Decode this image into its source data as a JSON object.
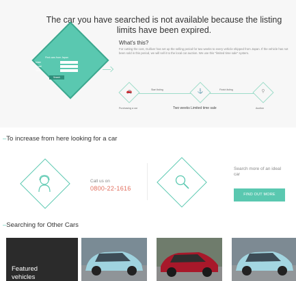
{
  "notice": {
    "headline_line1": "The car you have searched is not available because the listing",
    "headline_line2": "limits have been expired."
  },
  "search_card": {
    "title": "Find cars from Japan",
    "field1_label": "Make",
    "field2_label": "Model",
    "field3_label": "Year",
    "button_label": "Search"
  },
  "explainer": {
    "title": "What's this?",
    "body": "For cutting the cost, Gulliver has set up the selling period for two weeks to every vehicle shipped from Japan. If the vehicle has not been sold in this period, we will sell it to the local car auction. We use this \"limited time sale\" system."
  },
  "timeline": {
    "start_listing": "Start listing",
    "finish_listing": "Finish listing",
    "purchasing": "Purchasing a car",
    "period": "Two weeks Limited time sale",
    "auction": "Auction"
  },
  "contact": {
    "section_title": "To increase from here looking for a car",
    "call_label": "Call us on",
    "phone": "0800-22-1616",
    "search_label": "Search more of an ideal car",
    "find_button": "FIND OUT MORE"
  },
  "other_cars": {
    "section_title": "Searching for Other Cars",
    "featured_label_line1": "Featured",
    "featured_label_line2": "vehicles"
  },
  "colors": {
    "accent": "#5ac8b0",
    "phone": "#e26e5d",
    "featured_bg": "#2b2b2b"
  },
  "icons": [
    "car-icon",
    "ship-icon",
    "auction-icon",
    "person-icon",
    "search-icon",
    "arrow-right-icon"
  ]
}
